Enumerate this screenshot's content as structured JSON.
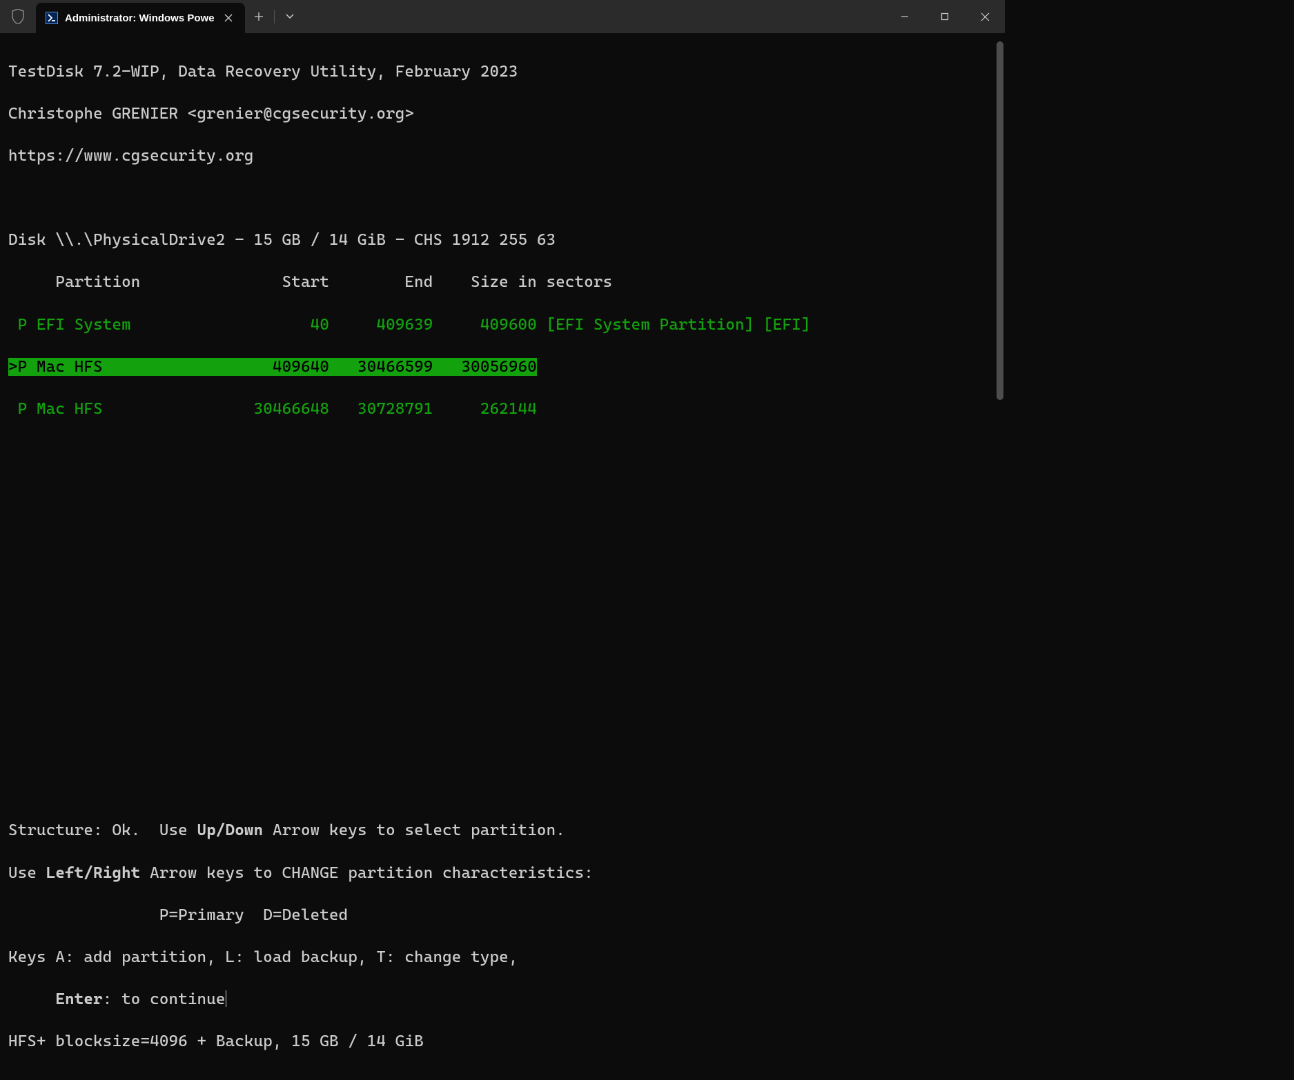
{
  "titlebar": {
    "tab_title": "Administrator: Windows Powe"
  },
  "header": {
    "line1": "TestDisk 7.2-WIP, Data Recovery Utility, February 2023",
    "line2": "Christophe GRENIER <grenier@cgsecurity.org>",
    "line3": "https://www.cgsecurity.org"
  },
  "disk_line": "Disk \\\\.\\PhysicalDrive2 - 15 GB / 14 GiB - CHS 1912 255 63",
  "columns": "     Partition               Start        End    Size in sectors",
  "partitions": [
    {
      "prefix": " P ",
      "row": "EFI System                   40     409639     409600",
      "suffix": " [EFI System Partition] [EFI]",
      "selected": false
    },
    {
      "prefix": ">P ",
      "row": "Mac HFS                  409640   30466599   30056960",
      "suffix": "",
      "selected": true
    },
    {
      "prefix": " P ",
      "row": "Mac HFS                30466648   30728791     262144",
      "suffix": "",
      "selected": false
    }
  ],
  "footer": {
    "l1a": "Structure: Ok.  Use ",
    "l1b": "Up/Down",
    "l1c": " Arrow keys to select partition.",
    "l2a": "Use ",
    "l2b": "Left/Right",
    "l2c": " Arrow keys to CHANGE partition characteristics:",
    "l3": "                P=Primary  D=Deleted",
    "l4": "Keys A: add partition, L: load backup, T: change type,",
    "l5a": "     ",
    "l5b": "Enter",
    "l5c": ": to continue",
    "l6": "HFS+ blocksize=4096 + Backup, 15 GB / 14 GiB"
  }
}
